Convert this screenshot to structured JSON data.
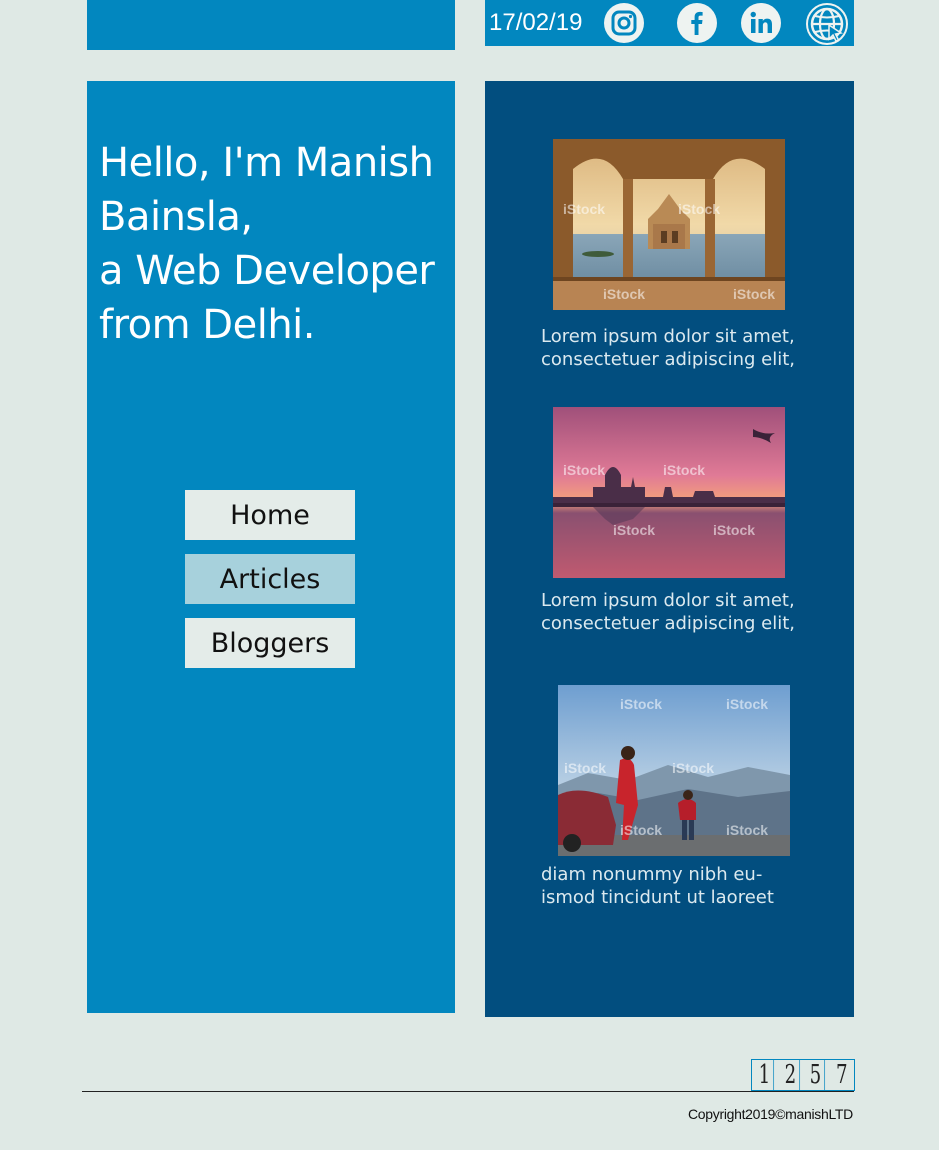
{
  "header": {
    "date": "17/02/19",
    "social": [
      {
        "name": "instagram-icon"
      },
      {
        "name": "facebook-icon"
      },
      {
        "name": "linkedin-icon"
      },
      {
        "name": "globe-link-icon"
      }
    ]
  },
  "hero": {
    "line1": "Hello, I'm Manish",
    "line2": "Bainsla,",
    "line3": "a Web Developer",
    "line4": "from Delhi."
  },
  "nav": {
    "home": "Home",
    "articles": "Articles",
    "bloggers": "Bloggers",
    "active": "Articles"
  },
  "articles": [
    {
      "image": "jaisalmer-lake-photo",
      "line1": "Lorem ipsum dolor sit amet,",
      "line2": "consectetuer adipiscing elit,"
    },
    {
      "image": "taj-mahal-sunset-photo",
      "line1": "Lorem ipsum dolor sit amet,",
      "line2": "consectetuer adipiscing elit,"
    },
    {
      "image": "mountain-family-photo",
      "line1": " diam nonummy nibh eu-",
      "line2": "ismod tincidunt ut laoreet"
    }
  ],
  "watermark": "iStock",
  "pagination": [
    "1",
    "2",
    "5",
    "7"
  ],
  "footer": {
    "copyright": "Copyright2019©manishLTD"
  },
  "colors": {
    "background": "#dfe9e5",
    "primary_blue": "#0287bf",
    "dark_blue": "#024e7f",
    "active_nav": "#a7d1dc"
  }
}
